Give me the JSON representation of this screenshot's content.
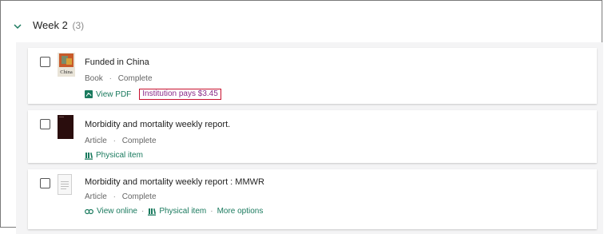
{
  "week": {
    "title": "Week 2",
    "count": "(3)"
  },
  "items": [
    {
      "title": "Funded in China",
      "type": "Book",
      "status": "Complete",
      "cover_text": "China",
      "action_pdf": "View PDF",
      "pay_badge": "Institution pays $3.45"
    },
    {
      "title": "Morbidity and mortality weekly report.",
      "type": "Article",
      "status": "Complete",
      "action_physical": "Physical item"
    },
    {
      "title": "Morbidity and mortality weekly report : MMWR",
      "type": "Article",
      "status": "Complete",
      "action_online": "View online",
      "action_physical": "Physical item",
      "action_more": "More options"
    }
  ],
  "meta_separator": "·",
  "colors": {
    "link": "#1a7a5e",
    "badge_border": "#c8102e",
    "badge_text": "#8a2b8a",
    "panel": "#f4f4f5"
  }
}
